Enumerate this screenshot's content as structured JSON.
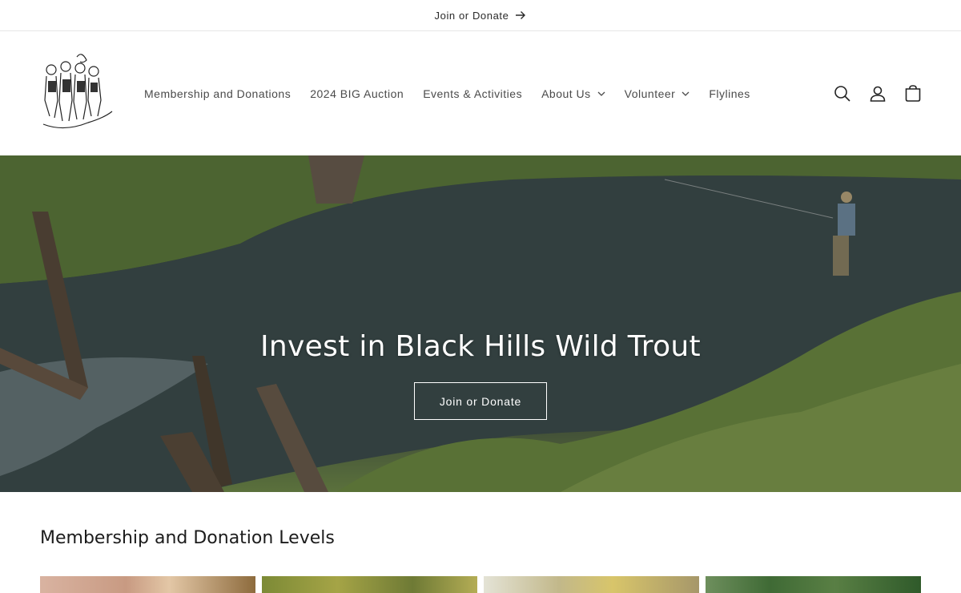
{
  "announcement": {
    "text": "Join or Donate"
  },
  "nav": {
    "items": [
      {
        "label": "Membership and Donations",
        "has_dropdown": false
      },
      {
        "label": "2024 BIG Auction",
        "has_dropdown": false
      },
      {
        "label": "Events & Activities",
        "has_dropdown": false
      },
      {
        "label": "About Us",
        "has_dropdown": true
      },
      {
        "label": "Volunteer",
        "has_dropdown": true
      },
      {
        "label": "Flylines",
        "has_dropdown": false
      }
    ]
  },
  "header_icons": [
    "search-icon",
    "account-icon",
    "cart-icon"
  ],
  "hero": {
    "title": "Invest in Black Hills Wild Trout",
    "button_label": "Join or Donate"
  },
  "section": {
    "title": "Membership and Donation Levels"
  },
  "colors": {
    "text": "#121212",
    "nav_text": "#4a4a4a",
    "hero_text": "#ffffff"
  }
}
